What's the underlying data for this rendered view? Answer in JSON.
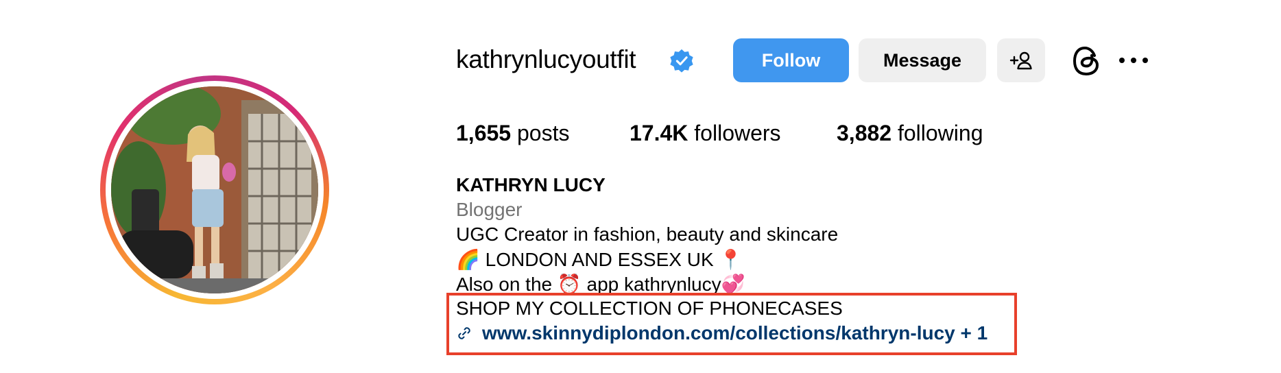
{
  "profile": {
    "username": "kathrynlucyoutfit",
    "verified": true,
    "buttons": {
      "follow": "Follow",
      "message": "Message"
    },
    "icons": [
      "verified-badge-icon",
      "add-user-icon",
      "threads-icon",
      "more-options-icon",
      "link-icon"
    ],
    "stats": {
      "posts_value": "1,655",
      "posts_label": "posts",
      "followers_value": "17.4K",
      "followers_label": "followers",
      "following_value": "3,882",
      "following_label": "following"
    },
    "bio": {
      "name": "KATHRYN LUCY",
      "category": "Blogger",
      "line1": "UGC Creator in fashion, beauty and skincare",
      "line2": "🌈 LONDON AND ESSEX UK 📍",
      "line3": "Also on the ⏰ app kathrynlucy💞",
      "line4": "SHOP MY COLLECTION OF PHONECASES",
      "link": "www.skinnydiplondon.com/collections/kathryn-lucy + 1"
    }
  },
  "colors": {
    "follow_button": "#4097ef",
    "secondary_button": "#efefef",
    "verified_badge": "#3897f0",
    "link_text": "#00376b",
    "category_text": "#737373",
    "highlight_box": "#e8402b"
  }
}
